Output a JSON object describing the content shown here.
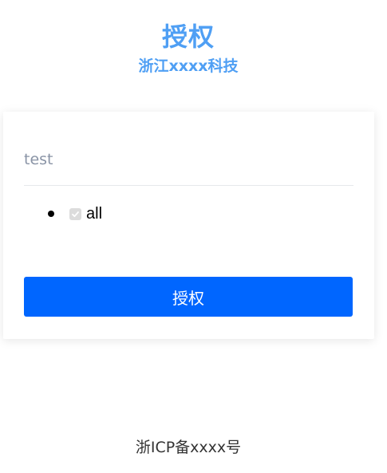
{
  "header": {
    "title": "授权",
    "subtitle": "浙江xxxx科技"
  },
  "form": {
    "input_value": "test",
    "permissions": [
      {
        "label": "all",
        "checked": true,
        "disabled": true
      }
    ],
    "submit_label": "授权"
  },
  "footer": {
    "icp_text": "浙ICP备xxxx号"
  },
  "colors": {
    "accent": "#4f9ff4",
    "button": "#0066ff",
    "input_text": "#8a94a6"
  }
}
